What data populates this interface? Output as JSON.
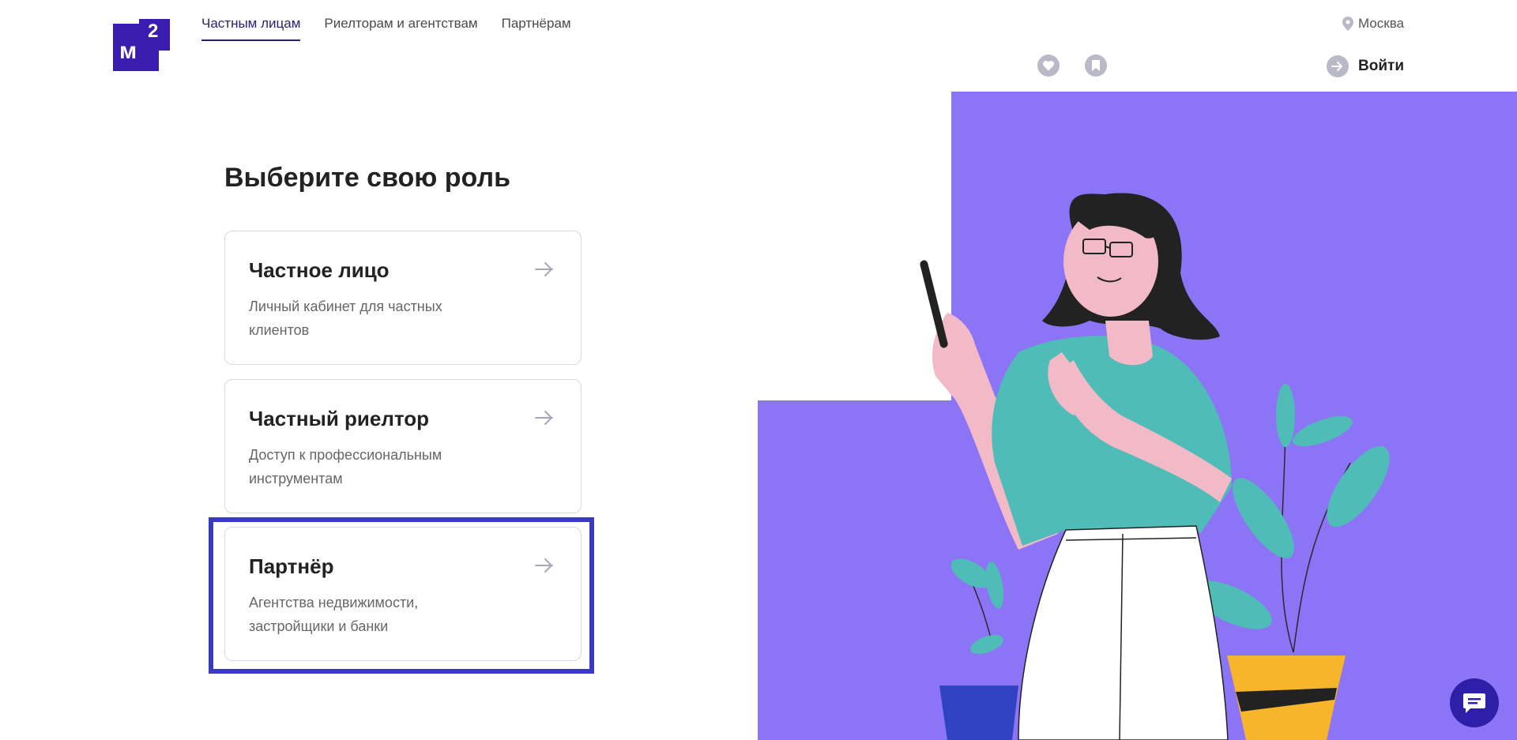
{
  "logo": {
    "letter": "м",
    "sup": "2"
  },
  "nav": {
    "items": [
      {
        "label": "Частным лицам",
        "active": true
      },
      {
        "label": "Риелторам и агентствам",
        "active": false
      },
      {
        "label": "Партнёрам",
        "active": false
      }
    ]
  },
  "header": {
    "city": "Москва",
    "login": "Войти",
    "icons": [
      "heart-icon",
      "bookmark-icon",
      "login-arrow-icon",
      "location-pin-icon"
    ]
  },
  "main": {
    "title": "Выберите свою роль",
    "cards": [
      {
        "title": "Частное лицо",
        "desc": "Личный кабинет для частных клиентов"
      },
      {
        "title": "Частный риелтор",
        "desc": "Доступ к профессиональным инструментам"
      },
      {
        "title": "Партнёр",
        "desc": "Агентства недвижимости, застройщики и банки"
      }
    ]
  },
  "colors": {
    "brand": "#3a1db0",
    "illustration_bg": "#8c74f7",
    "highlight": "#3b3bbf",
    "shirt": "#4fbcb8",
    "skin": "#f2b9c6"
  }
}
